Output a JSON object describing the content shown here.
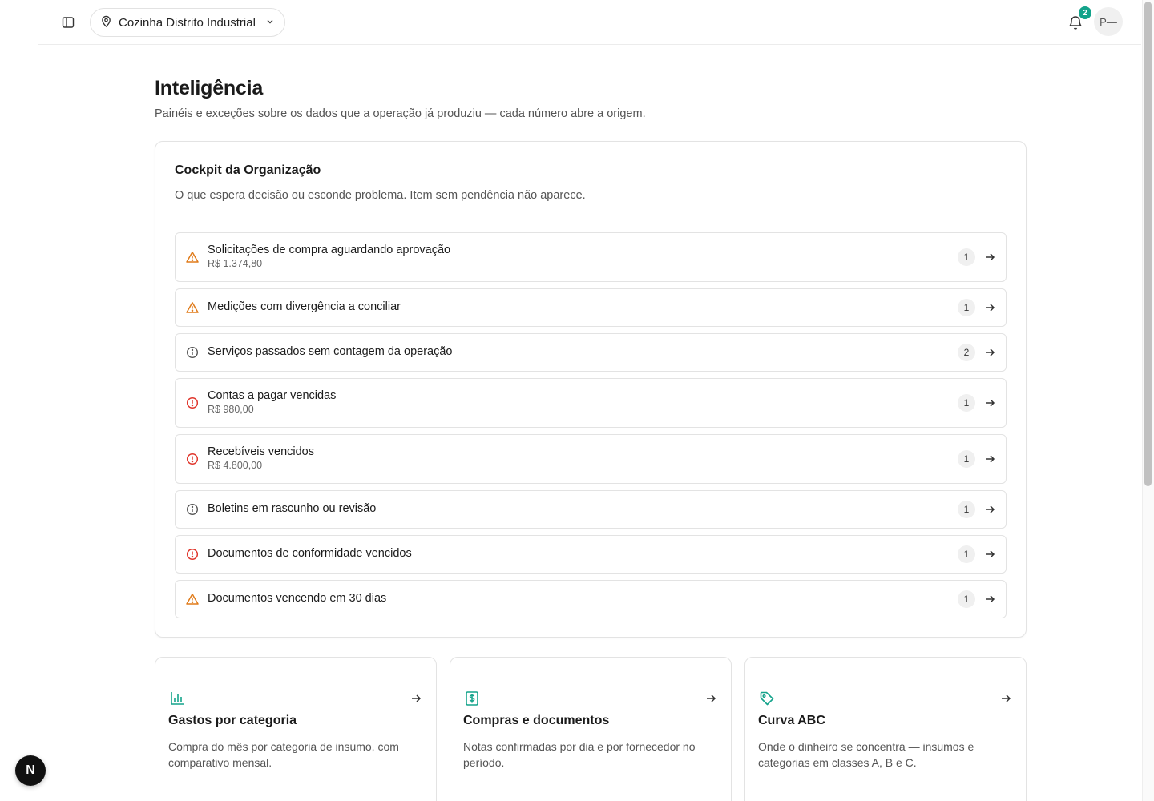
{
  "topbar": {
    "location": "Cozinha Distrito Industrial",
    "notification_count": "2",
    "avatar_initials": "P—"
  },
  "header": {
    "title": "Inteligência",
    "subtitle": "Painéis e exceções sobre os dados que a operação já produziu — cada número abre a origem."
  },
  "cockpit": {
    "title": "Cockpit da Organização",
    "subtitle": "O que espera decisão ou esconde problema. Item sem pendência não aparece.",
    "items": [
      {
        "label": "Solicitações de compra aguardando aprovação",
        "amount": "R$ 1.374,80",
        "count": "1",
        "severity": "warning-icon"
      },
      {
        "label": "Medições com divergência a conciliar",
        "count": "1",
        "severity": "warning-icon"
      },
      {
        "label": "Serviços passados sem contagem da operação",
        "count": "2",
        "severity": "info-icon"
      },
      {
        "label": "Contas a pagar vencidas",
        "amount": "R$ 980,00",
        "count": "1",
        "severity": "alert-icon"
      },
      {
        "label": "Recebíveis vencidos",
        "amount": "R$ 4.800,00",
        "count": "1",
        "severity": "alert-icon"
      },
      {
        "label": "Boletins em rascunho ou revisão",
        "count": "1",
        "severity": "info-icon"
      },
      {
        "label": "Documentos de conformidade vencidos",
        "count": "1",
        "severity": "alert-icon"
      },
      {
        "label": "Documentos vencendo em 30 dias",
        "count": "1",
        "severity": "warning-icon"
      }
    ]
  },
  "cards": [
    {
      "title": "Gastos por categoria",
      "description": "Compra do mês por categoria de insumo, com comparativo mensal.",
      "icon": "bar-chart-icon"
    },
    {
      "title": "Compras e documentos",
      "description": "Notas confirmadas por dia e por fornecedor no período.",
      "icon": "receipt-dollar-icon"
    },
    {
      "title": "Curva ABC",
      "description": "Onde o dinheiro se concentra — insumos e categorias em classes A, B e C.",
      "icon": "tag-icon"
    }
  ],
  "colors": {
    "warning": "#e07b1a",
    "alert": "#e0362c",
    "info": "#555555",
    "accent": "#14a38b"
  },
  "dev_badge": "N"
}
